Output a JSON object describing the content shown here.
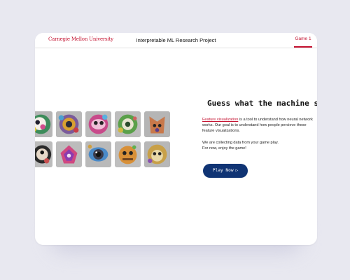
{
  "header": {
    "brand": "Carnegie Mellon University",
    "title": "Interpretable ML Research Project",
    "tab": "Game 1"
  },
  "main": {
    "headline": "Guess what the machine sees",
    "intro_link": "Feature visualization",
    "intro_rest": " is a tool to understand how neural network works. Our goal is to understand how people percieve these feature visualizations.",
    "collect_line1": "We are collecting data from your game play.",
    "collect_line2": "For now, enjoy the game!",
    "play_label": "Play Now",
    "play_icon": "play-icon"
  },
  "gallery": {
    "rows": [
      [
        "fox-face-feature",
        "bird-eye-feature",
        "doll-face-feature",
        "frog-face-feature",
        "wolf-face-feature"
      ],
      [
        "bear-face-feature",
        "fish-face-feature",
        "eye-feature",
        "tiger-face-feature",
        "lion-face-feature"
      ]
    ]
  },
  "colors": {
    "brand_red": "#c41230",
    "button_navy": "#103474",
    "background": "#e8e8f0"
  }
}
